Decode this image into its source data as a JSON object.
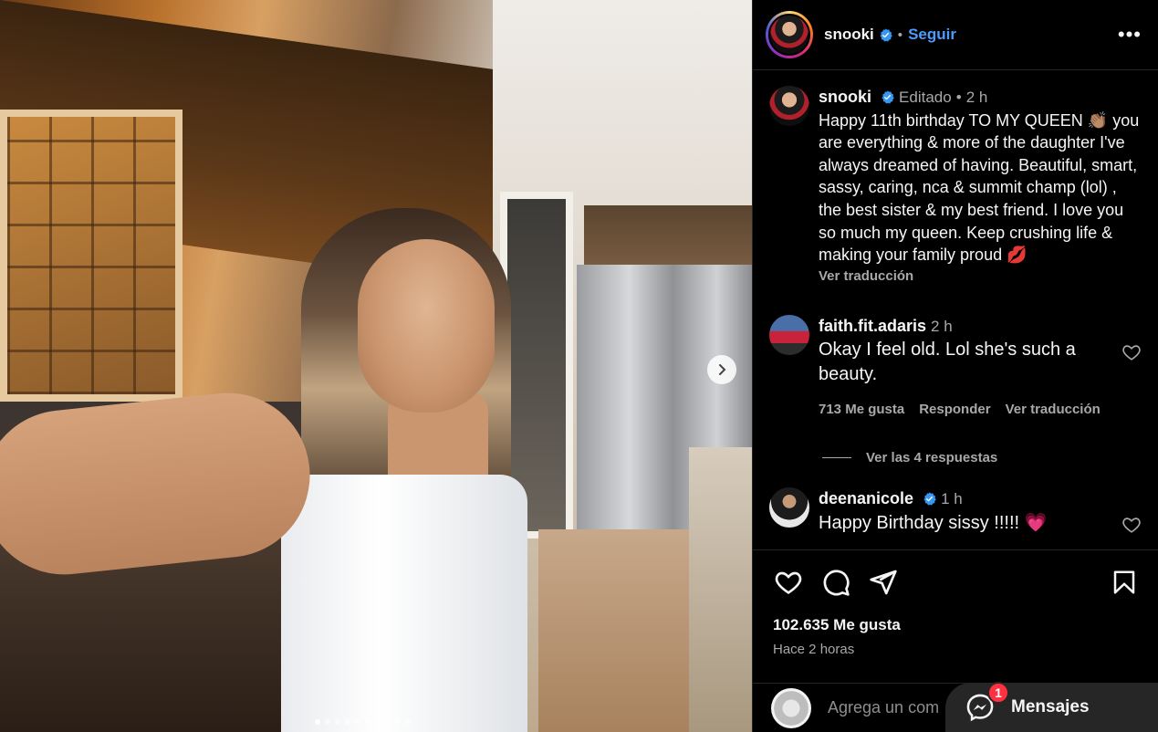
{
  "header": {
    "username": "snooki",
    "separator": "•",
    "follow_label": "Seguir",
    "more_label": "•••"
  },
  "caption": {
    "username": "snooki",
    "edited": "Editado",
    "separator": "•",
    "time": "2 h",
    "text": "Happy 11th birthday TO MY QUEEN 👏🏽 you are everything & more of the daughter I've always dreamed of having. Beautiful, smart, sassy, caring, nca & summit champ (lol) , the best sister & my best friend. I love you so much my queen. Keep crushing life & making your family proud 💋",
    "translate_label": "Ver traducción"
  },
  "comments": [
    {
      "username": "faith.fit.adaris",
      "time": "2 h",
      "text": "Okay I feel old. Lol she's such a beauty.",
      "likes_label": "713 Me gusta",
      "reply_label": "Responder",
      "translate_label": "Ver traducción",
      "replies_label": "Ver las 4 respuestas"
    },
    {
      "username": "deenanicole",
      "time": "1 h",
      "text": "Happy Birthday sissy !!!!! 💗"
    }
  ],
  "stats": {
    "likes": "102.635 Me gusta",
    "posted": "Hace 2 horas"
  },
  "comment_input": {
    "placeholder": "Agrega un com"
  },
  "messages": {
    "label": "Mensajes",
    "badge": "1"
  },
  "icons": {
    "verified": "verified-badge-icon",
    "like": "heart-icon",
    "comment": "comment-bubble-icon",
    "share": "paper-plane-icon",
    "save": "bookmark-icon",
    "next": "chevron-right-icon",
    "messenger": "messenger-icon"
  },
  "colors": {
    "accent_link": "#4a9dff",
    "verified": "#3897f0",
    "badge": "#ff3040",
    "background": "#000000"
  },
  "carousel": {
    "slide_count": 10,
    "active_index": 0
  }
}
